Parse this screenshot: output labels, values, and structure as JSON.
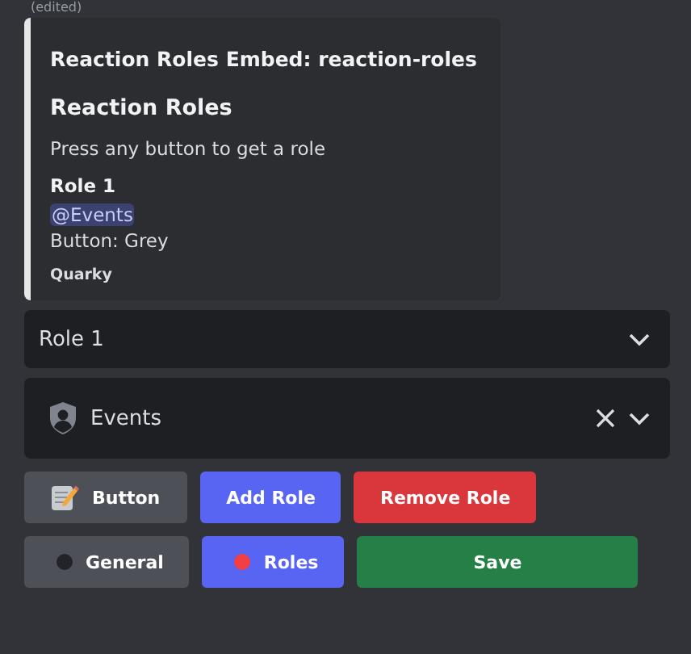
{
  "message": {
    "edited_label": "(edited)",
    "embed": {
      "author": "Reaction Roles Embed: reaction-roles",
      "title": "Reaction Roles",
      "description": "Press any button to get a role",
      "field": {
        "name": "Role 1",
        "mention": "@Events",
        "value": "Button: Grey"
      },
      "footer": "Quarky"
    }
  },
  "selects": [
    {
      "kind": "plain",
      "value": "Role 1",
      "clearable": false
    },
    {
      "kind": "role",
      "value": "Events",
      "clearable": true
    }
  ],
  "button_rows": [
    [
      {
        "label": "Button",
        "color": "#4e5058",
        "kind": "icon"
      },
      {
        "label": "Add Role",
        "color": "#5865f2",
        "kind": "plain"
      },
      {
        "label": "Remove Role",
        "color": "#da373c",
        "kind": "plain"
      }
    ],
    [
      {
        "label": "General",
        "color": "#4e5058",
        "kind": "dot",
        "dot": {
          "color": "#222327"
        }
      },
      {
        "label": "Roles",
        "color": "#5865f2",
        "kind": "dot",
        "dot": {
          "color": "#f23f43"
        }
      },
      {
        "label": "Save",
        "color": "#248046",
        "kind": "wide"
      }
    ]
  ]
}
